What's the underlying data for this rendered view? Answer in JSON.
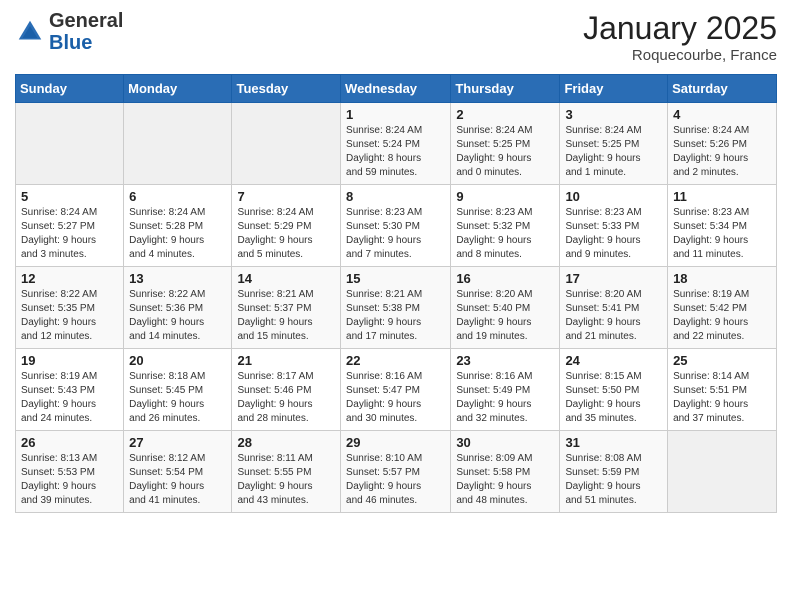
{
  "header": {
    "logo": {
      "text_general": "General",
      "text_blue": "Blue"
    },
    "title": "January 2025",
    "location": "Roquecourbe, France"
  },
  "calendar": {
    "days_of_week": [
      "Sunday",
      "Monday",
      "Tuesday",
      "Wednesday",
      "Thursday",
      "Friday",
      "Saturday"
    ],
    "weeks": [
      [
        {
          "day": "",
          "info": ""
        },
        {
          "day": "",
          "info": ""
        },
        {
          "day": "",
          "info": ""
        },
        {
          "day": "1",
          "info": "Sunrise: 8:24 AM\nSunset: 5:24 PM\nDaylight: 8 hours\nand 59 minutes."
        },
        {
          "day": "2",
          "info": "Sunrise: 8:24 AM\nSunset: 5:25 PM\nDaylight: 9 hours\nand 0 minutes."
        },
        {
          "day": "3",
          "info": "Sunrise: 8:24 AM\nSunset: 5:25 PM\nDaylight: 9 hours\nand 1 minute."
        },
        {
          "day": "4",
          "info": "Sunrise: 8:24 AM\nSunset: 5:26 PM\nDaylight: 9 hours\nand 2 minutes."
        }
      ],
      [
        {
          "day": "5",
          "info": "Sunrise: 8:24 AM\nSunset: 5:27 PM\nDaylight: 9 hours\nand 3 minutes."
        },
        {
          "day": "6",
          "info": "Sunrise: 8:24 AM\nSunset: 5:28 PM\nDaylight: 9 hours\nand 4 minutes."
        },
        {
          "day": "7",
          "info": "Sunrise: 8:24 AM\nSunset: 5:29 PM\nDaylight: 9 hours\nand 5 minutes."
        },
        {
          "day": "8",
          "info": "Sunrise: 8:23 AM\nSunset: 5:30 PM\nDaylight: 9 hours\nand 7 minutes."
        },
        {
          "day": "9",
          "info": "Sunrise: 8:23 AM\nSunset: 5:32 PM\nDaylight: 9 hours\nand 8 minutes."
        },
        {
          "day": "10",
          "info": "Sunrise: 8:23 AM\nSunset: 5:33 PM\nDaylight: 9 hours\nand 9 minutes."
        },
        {
          "day": "11",
          "info": "Sunrise: 8:23 AM\nSunset: 5:34 PM\nDaylight: 9 hours\nand 11 minutes."
        }
      ],
      [
        {
          "day": "12",
          "info": "Sunrise: 8:22 AM\nSunset: 5:35 PM\nDaylight: 9 hours\nand 12 minutes."
        },
        {
          "day": "13",
          "info": "Sunrise: 8:22 AM\nSunset: 5:36 PM\nDaylight: 9 hours\nand 14 minutes."
        },
        {
          "day": "14",
          "info": "Sunrise: 8:21 AM\nSunset: 5:37 PM\nDaylight: 9 hours\nand 15 minutes."
        },
        {
          "day": "15",
          "info": "Sunrise: 8:21 AM\nSunset: 5:38 PM\nDaylight: 9 hours\nand 17 minutes."
        },
        {
          "day": "16",
          "info": "Sunrise: 8:20 AM\nSunset: 5:40 PM\nDaylight: 9 hours\nand 19 minutes."
        },
        {
          "day": "17",
          "info": "Sunrise: 8:20 AM\nSunset: 5:41 PM\nDaylight: 9 hours\nand 21 minutes."
        },
        {
          "day": "18",
          "info": "Sunrise: 8:19 AM\nSunset: 5:42 PM\nDaylight: 9 hours\nand 22 minutes."
        }
      ],
      [
        {
          "day": "19",
          "info": "Sunrise: 8:19 AM\nSunset: 5:43 PM\nDaylight: 9 hours\nand 24 minutes."
        },
        {
          "day": "20",
          "info": "Sunrise: 8:18 AM\nSunset: 5:45 PM\nDaylight: 9 hours\nand 26 minutes."
        },
        {
          "day": "21",
          "info": "Sunrise: 8:17 AM\nSunset: 5:46 PM\nDaylight: 9 hours\nand 28 minutes."
        },
        {
          "day": "22",
          "info": "Sunrise: 8:16 AM\nSunset: 5:47 PM\nDaylight: 9 hours\nand 30 minutes."
        },
        {
          "day": "23",
          "info": "Sunrise: 8:16 AM\nSunset: 5:49 PM\nDaylight: 9 hours\nand 32 minutes."
        },
        {
          "day": "24",
          "info": "Sunrise: 8:15 AM\nSunset: 5:50 PM\nDaylight: 9 hours\nand 35 minutes."
        },
        {
          "day": "25",
          "info": "Sunrise: 8:14 AM\nSunset: 5:51 PM\nDaylight: 9 hours\nand 37 minutes."
        }
      ],
      [
        {
          "day": "26",
          "info": "Sunrise: 8:13 AM\nSunset: 5:53 PM\nDaylight: 9 hours\nand 39 minutes."
        },
        {
          "day": "27",
          "info": "Sunrise: 8:12 AM\nSunset: 5:54 PM\nDaylight: 9 hours\nand 41 minutes."
        },
        {
          "day": "28",
          "info": "Sunrise: 8:11 AM\nSunset: 5:55 PM\nDaylight: 9 hours\nand 43 minutes."
        },
        {
          "day": "29",
          "info": "Sunrise: 8:10 AM\nSunset: 5:57 PM\nDaylight: 9 hours\nand 46 minutes."
        },
        {
          "day": "30",
          "info": "Sunrise: 8:09 AM\nSunset: 5:58 PM\nDaylight: 9 hours\nand 48 minutes."
        },
        {
          "day": "31",
          "info": "Sunrise: 8:08 AM\nSunset: 5:59 PM\nDaylight: 9 hours\nand 51 minutes."
        },
        {
          "day": "",
          "info": ""
        }
      ]
    ]
  }
}
